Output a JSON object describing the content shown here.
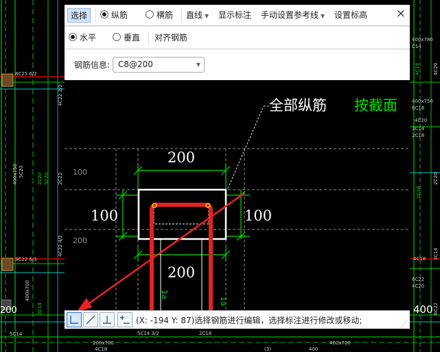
{
  "toolbar1": {
    "select": "选择",
    "longitudinal": "纵筋",
    "transverse": "横筋",
    "line": "直线",
    "show_labels": "显示标注",
    "manual_ref": "手动设置参考线",
    "set_height": "设置标高",
    "close": "×"
  },
  "toolbar2": {
    "horizontal": "水平",
    "vertical": "垂直",
    "align": "对齐钢筋"
  },
  "info": {
    "label": "钢筋信息:",
    "value": "C8@200"
  },
  "drawing": {
    "all_long": "全部纵筋",
    "by_section": "按截面",
    "dim_top": "200",
    "dim_bottom": "200",
    "dim_left": "100",
    "dim_right": "100",
    "grid_100": "100",
    "grid_200": "200",
    "vert_label": "1a"
  },
  "status": {
    "text": "(X: -194 Y: 87)选择钢筋进行编辑，选择标注进行修改或移动;"
  },
  "background_cad": {
    "labels": [
      "8C25 6/2",
      "4C22 2/2",
      "400x750",
      "5C20",
      "4C18",
      "9C22 6/3",
      "4C22 4/2",
      "2C22",
      "2C20",
      "400x700",
      "5C14",
      "3C14",
      "(1)",
      "5C14 3/2",
      "2C18",
      "200x700",
      "4C18",
      "(3)",
      "400x700",
      "C14",
      "2C18",
      "4C20",
      "2C20",
      "400x780",
      "6C18",
      "3C14",
      "4C20",
      "6C22",
      "400",
      "200"
    ]
  }
}
